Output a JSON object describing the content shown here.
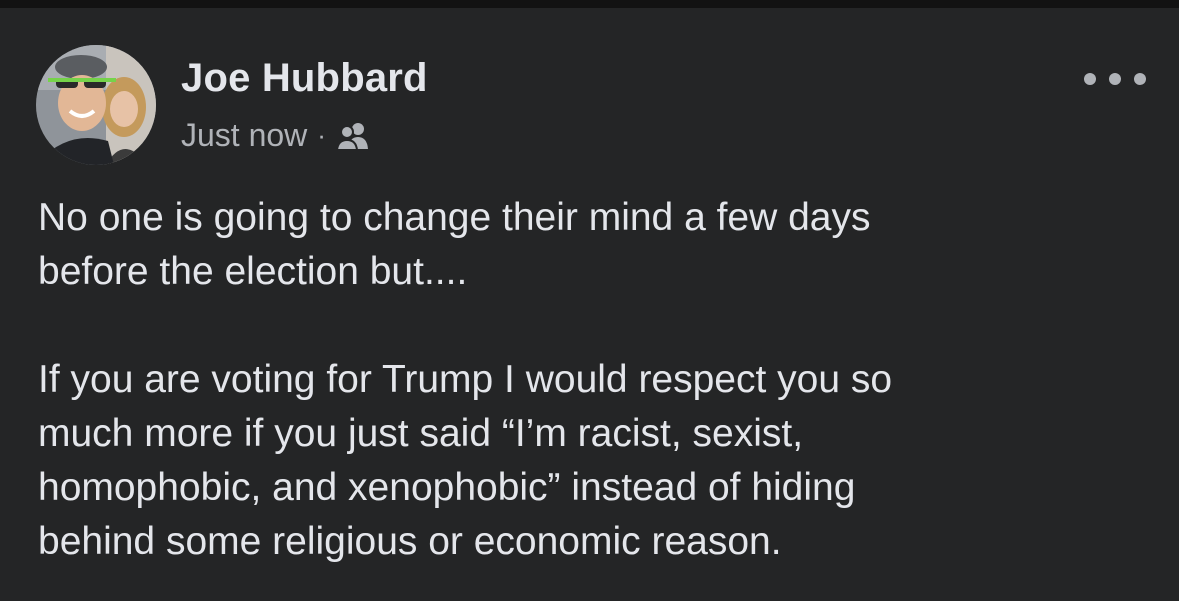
{
  "post": {
    "author_name": "Joe Hubbard",
    "timestamp": "Just now",
    "separator": "·",
    "audience_icon": "friends-icon",
    "more_icon": "more-horizontal-icon",
    "paragraphs": [
      "No one is going to change their mind a few days\nbefore the election but....",
      "If you are voting for Trump I would respect you so\nmuch more if you just said “I’m racist, sexist,\nhomophobic, and xenophobic” instead of hiding\nbehind some religious or economic reason."
    ]
  },
  "colors": {
    "background": "#242526",
    "top_strip": "#121212",
    "primary_text": "#e4e6eb",
    "secondary_text": "#b0b3b8"
  }
}
